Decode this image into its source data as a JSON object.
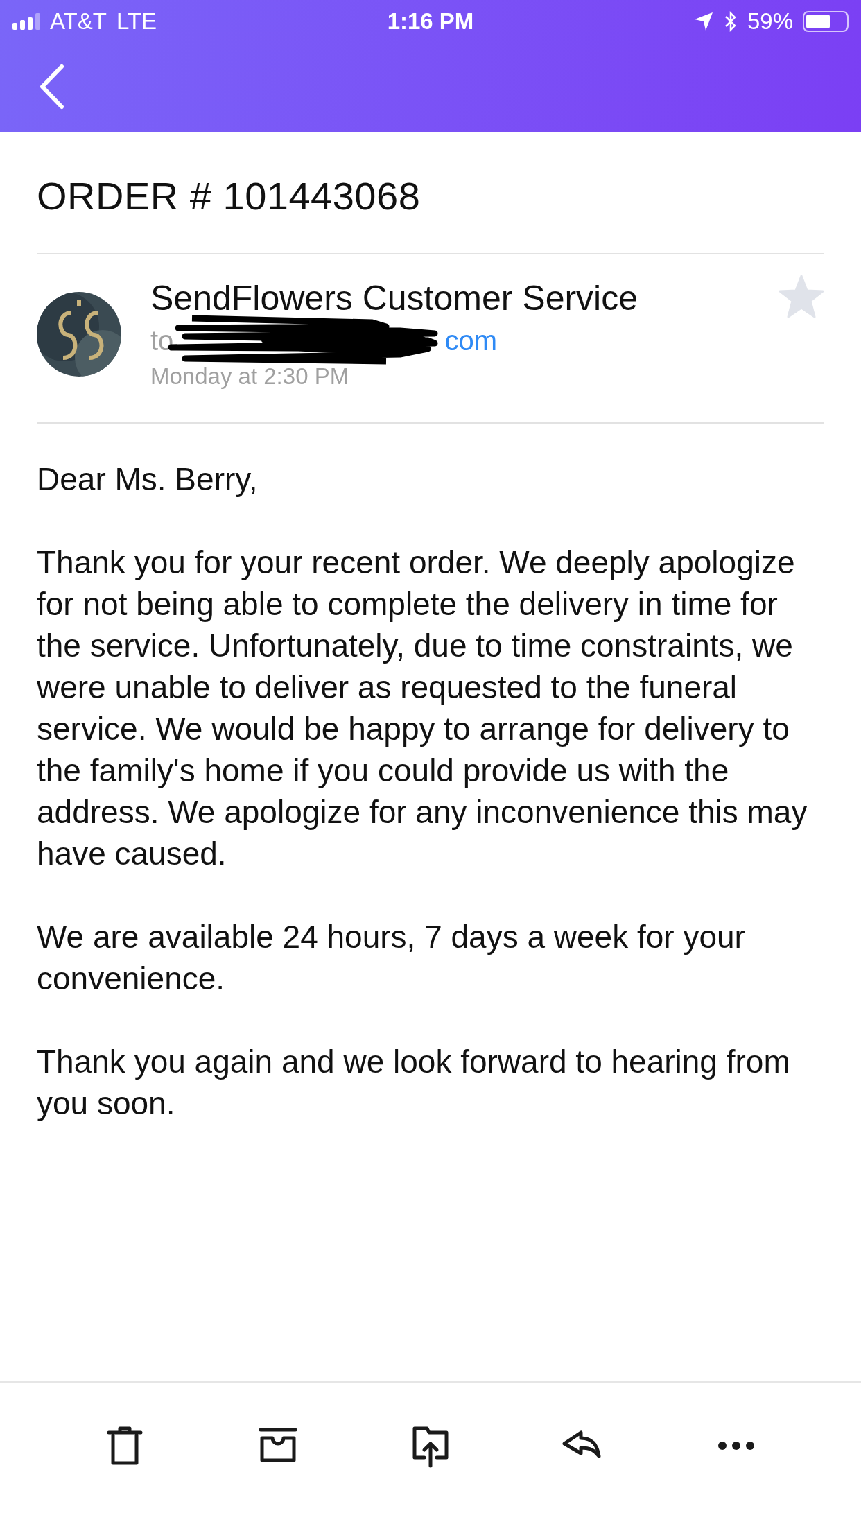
{
  "status_bar": {
    "carrier": "AT&T",
    "network": "LTE",
    "time": "1:16 PM",
    "battery_percent": "59%"
  },
  "email": {
    "subject": "ORDER # 101443068",
    "sender": "SendFlowers Customer Service",
    "to_label": "to",
    "recipient_visible": "com",
    "date": "Monday at 2:30 PM",
    "starred": false,
    "body": [
      "Dear Ms. Berry,",
      "Thank you for your recent order. We deeply apologize for not being able to complete the delivery in time for the service. Unfortunately, due to time constraints, we were unable to deliver as requested to the funeral service. We would be happy to arrange for delivery to the family's home if you could provide us with the address. We apologize for any inconvenience this may have caused.",
      "We are available 24 hours, 7 days a week for your convenience.",
      "Thank you again and we look forward to hearing from you soon."
    ]
  },
  "toolbar": [
    {
      "kind": "trash"
    },
    {
      "kind": "archive"
    },
    {
      "kind": "move"
    },
    {
      "kind": "reply"
    },
    {
      "kind": "more"
    }
  ]
}
